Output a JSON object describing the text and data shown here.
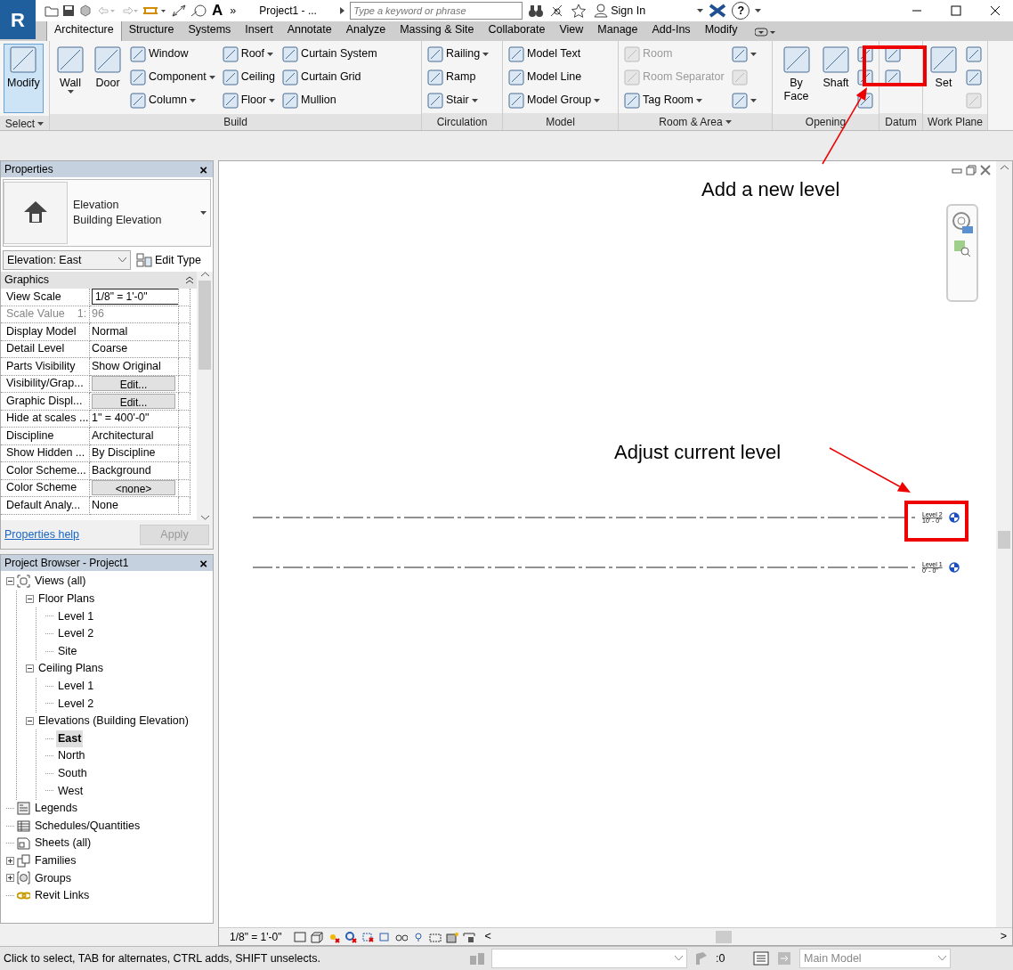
{
  "title_bar": {
    "logo": "R",
    "font_tool": "A",
    "more": "»",
    "title": "Project1 - ...",
    "search": {
      "placeholder": "Type a keyword or phrase"
    },
    "sign_in": "Sign In",
    "help": "?"
  },
  "tabs": [
    {
      "label": "Architecture",
      "selected": true
    },
    {
      "label": "Structure",
      "selected": false
    },
    {
      "label": "Systems",
      "selected": false
    },
    {
      "label": "Insert",
      "selected": false
    },
    {
      "label": "Annotate",
      "selected": false
    },
    {
      "label": "Analyze",
      "selected": false
    },
    {
      "label": "Massing & Site",
      "selected": false
    },
    {
      "label": "Collaborate",
      "selected": false
    },
    {
      "label": "View",
      "selected": false
    },
    {
      "label": "Manage",
      "selected": false
    },
    {
      "label": "Add-Ins",
      "selected": false
    },
    {
      "label": "Modify",
      "selected": false
    }
  ],
  "ribbon": [
    {
      "label": "Select",
      "dropdown": true,
      "tools": [
        {
          "kind": "large",
          "label": "Modify",
          "selected": true,
          "dropdown": false,
          "disabled": false
        }
      ]
    },
    {
      "label": "Build",
      "dropdown": false,
      "tools": [
        {
          "kind": "large",
          "label": "Wall",
          "selected": false,
          "dropdown": true,
          "disabled": false
        },
        {
          "kind": "large",
          "label": "Door",
          "selected": false,
          "dropdown": false,
          "disabled": false
        },
        {
          "kind": "small",
          "label": "Window",
          "selected": false,
          "dropdown": false,
          "disabled": false
        },
        {
          "kind": "small",
          "label": "Component",
          "selected": false,
          "dropdown": true,
          "disabled": false
        },
        {
          "kind": "small",
          "label": "Column",
          "selected": false,
          "dropdown": true,
          "disabled": false
        },
        {
          "kind": "small",
          "label": "Roof",
          "selected": false,
          "dropdown": true,
          "disabled": false
        },
        {
          "kind": "small",
          "label": "Ceiling",
          "selected": false,
          "dropdown": false,
          "disabled": false
        },
        {
          "kind": "small",
          "label": "Floor",
          "selected": false,
          "dropdown": true,
          "disabled": false
        },
        {
          "kind": "small",
          "label": "Curtain System",
          "selected": false,
          "dropdown": false,
          "disabled": false
        },
        {
          "kind": "small",
          "label": "Curtain Grid",
          "selected": false,
          "dropdown": false,
          "disabled": false
        },
        {
          "kind": "small",
          "label": "Mullion",
          "selected": false,
          "dropdown": false,
          "disabled": false
        }
      ]
    },
    {
      "label": "Circulation",
      "dropdown": false,
      "tools": [
        {
          "kind": "small",
          "label": "Railing",
          "selected": false,
          "dropdown": true,
          "disabled": false
        },
        {
          "kind": "small",
          "label": "Ramp",
          "selected": false,
          "dropdown": false,
          "disabled": false
        },
        {
          "kind": "small",
          "label": "Stair",
          "selected": false,
          "dropdown": true,
          "disabled": false
        }
      ]
    },
    {
      "label": "Model",
      "dropdown": false,
      "tools": [
        {
          "kind": "small",
          "label": "Model Text",
          "selected": false,
          "dropdown": false,
          "disabled": false
        },
        {
          "kind": "small",
          "label": "Model Line",
          "selected": false,
          "dropdown": false,
          "disabled": false
        },
        {
          "kind": "small",
          "label": "Model Group",
          "selected": false,
          "dropdown": true,
          "disabled": false
        }
      ]
    },
    {
      "label": "Room & Area",
      "dropdown": true,
      "tools": [
        {
          "kind": "small",
          "label": "Room",
          "selected": false,
          "dropdown": false,
          "disabled": true
        },
        {
          "kind": "small",
          "label": "Room Separator",
          "selected": false,
          "dropdown": false,
          "disabled": true
        },
        {
          "kind": "small",
          "label": "Tag Room",
          "selected": false,
          "dropdown": true,
          "disabled": false
        },
        {
          "kind": "icon",
          "selected": false,
          "dropdown": true,
          "disabled": false
        },
        {
          "kind": "icon",
          "selected": false,
          "dropdown": false,
          "disabled": true
        },
        {
          "kind": "icon",
          "selected": false,
          "dropdown": true,
          "disabled": false
        }
      ]
    },
    {
      "label": "Opening",
      "dropdown": false,
      "tools": [
        {
          "kind": "large",
          "label": "By Face",
          "selected": false,
          "dropdown": false,
          "disabled": false
        },
        {
          "kind": "large",
          "label": "Shaft",
          "selected": false,
          "dropdown": false,
          "disabled": false
        },
        {
          "kind": "icon",
          "selected": false,
          "dropdown": false,
          "disabled": false
        },
        {
          "kind": "icon",
          "selected": false,
          "dropdown": false,
          "disabled": false
        },
        {
          "kind": "icon",
          "selected": false,
          "dropdown": false,
          "disabled": false
        }
      ]
    },
    {
      "label": "Datum",
      "dropdown": false,
      "tools": [
        {
          "kind": "icon",
          "selected": false,
          "dropdown": false,
          "disabled": false
        },
        {
          "kind": "icon",
          "selected": false,
          "dropdown": false,
          "disabled": false
        }
      ]
    },
    {
      "label": "Work Plane",
      "dropdown": false,
      "tools": [
        {
          "kind": "large",
          "label": "Set",
          "selected": false,
          "dropdown": false,
          "disabled": false
        },
        {
          "kind": "icon",
          "selected": false,
          "dropdown": false,
          "disabled": false
        },
        {
          "kind": "icon",
          "selected": false,
          "dropdown": false,
          "disabled": false
        },
        {
          "kind": "icon",
          "selected": false,
          "dropdown": false,
          "disabled": true
        }
      ]
    }
  ],
  "properties": {
    "title": "Properties",
    "close": "×",
    "type_name": "Elevation",
    "type_family": "Building Elevation",
    "selector": "Elevation: East",
    "edit_type": "Edit Type",
    "group": "Graphics",
    "rows": [
      {
        "name": "View Scale",
        "value": "1/8\" = 1'-0\"",
        "kind": "field",
        "disabled": false
      },
      {
        "name": "Scale Value    1:",
        "value": "96",
        "kind": "text",
        "disabled": true
      },
      {
        "name": "Display Model",
        "value": "Normal",
        "kind": "text",
        "disabled": false
      },
      {
        "name": "Detail Level",
        "value": "Coarse",
        "kind": "text",
        "disabled": false
      },
      {
        "name": "Parts Visibility",
        "value": "Show Original",
        "kind": "text",
        "disabled": false
      },
      {
        "name": "Visibility/Grap...",
        "value": "Edit...",
        "kind": "button",
        "disabled": false
      },
      {
        "name": "Graphic Displ...",
        "value": "Edit...",
        "kind": "button",
        "disabled": false
      },
      {
        "name": "Hide at scales ...",
        "value": "1\" = 400'-0\"",
        "kind": "text",
        "disabled": false
      },
      {
        "name": "Discipline",
        "value": "Architectural",
        "kind": "text",
        "disabled": false
      },
      {
        "name": "Show Hidden ...",
        "value": "By Discipline",
        "kind": "text",
        "disabled": false
      },
      {
        "name": "Color Scheme...",
        "value": "Background",
        "kind": "text",
        "disabled": false
      },
      {
        "name": "Color Scheme",
        "value": "<none>",
        "kind": "button",
        "disabled": false
      },
      {
        "name": "Default Analy...",
        "value": "None",
        "kind": "text",
        "disabled": false
      }
    ],
    "help_link": "Properties help",
    "apply": {
      "label": "Apply",
      "disabled": true
    }
  },
  "project_browser": {
    "title": "Project Browser - Project1",
    "close": "×",
    "tree": [
      {
        "label": "Views (all)",
        "kind": "views",
        "expanded": true,
        "selected": false,
        "children": [
          {
            "label": "Floor Plans",
            "expanded": true,
            "selected": false,
            "children": [
              {
                "label": "Level 1",
                "selected": false
              },
              {
                "label": "Level 2",
                "selected": false
              },
              {
                "label": "Site",
                "selected": false
              }
            ]
          },
          {
            "label": "Ceiling Plans",
            "expanded": true,
            "selected": false,
            "children": [
              {
                "label": "Level 1",
                "selected": false
              },
              {
                "label": "Level 2",
                "selected": false
              }
            ]
          },
          {
            "label": "Elevations (Building Elevation)",
            "expanded": true,
            "selected": false,
            "children": [
              {
                "label": "East",
                "selected": true
              },
              {
                "label": "North",
                "selected": false
              },
              {
                "label": "South",
                "selected": false
              },
              {
                "label": "West",
                "selected": false
              }
            ]
          }
        ]
      },
      {
        "label": "Legends",
        "kind": "legend",
        "selected": false
      },
      {
        "label": "Schedules/Quantities",
        "kind": "schedule",
        "selected": false
      },
      {
        "label": "Sheets (all)",
        "kind": "sheet",
        "selected": false
      },
      {
        "label": "Families",
        "kind": "family",
        "expanded": false,
        "selected": false
      },
      {
        "label": "Groups",
        "kind": "group",
        "expanded": false,
        "selected": false
      },
      {
        "label": "Revit Links",
        "kind": "link",
        "selected": false
      }
    ]
  },
  "view": {
    "levels": [
      {
        "name": "Level 2",
        "elevation": "10' - 0\""
      },
      {
        "name": "Level 1",
        "elevation": "0' - 0\""
      }
    ],
    "annotations": [
      {
        "text": "Add a new level"
      },
      {
        "text": "Adjust current level"
      }
    ],
    "view_bar": {
      "scale": "1/8\" = 1'-0\"",
      "scroll_left": "<",
      "scroll_right": ">"
    }
  },
  "status_bar": {
    "message": "Click to select, TAB for alternates, CTRL adds, SHIFT unselects.",
    "count": ":0",
    "model": "Main Model"
  }
}
